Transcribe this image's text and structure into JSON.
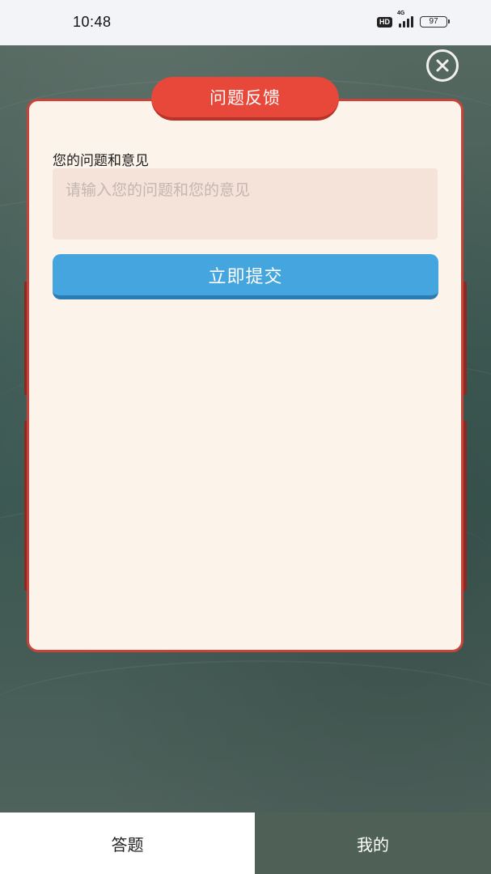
{
  "status_bar": {
    "time": "10:48",
    "hd_label": "HD",
    "network_label": "4G",
    "battery_level": "97"
  },
  "dialog": {
    "title": "问题反馈",
    "field_label": "您的问题和意见",
    "input_value": "",
    "input_placeholder": "请输入您的问题和您的意见",
    "submit_label": "立即提交"
  },
  "tabbar": {
    "tabs": [
      {
        "label": "答题",
        "active": true
      },
      {
        "label": "我的",
        "active": false
      }
    ]
  },
  "colors": {
    "title_pill": "#e8483a",
    "submit_button": "#45a5df",
    "dialog_border": "#c8443a",
    "dialog_background": "#fcf3ea",
    "input_background": "#f5e2d8",
    "tab_mine_background": "#4f6157"
  },
  "icons": {
    "close": "close-circle-icon"
  }
}
